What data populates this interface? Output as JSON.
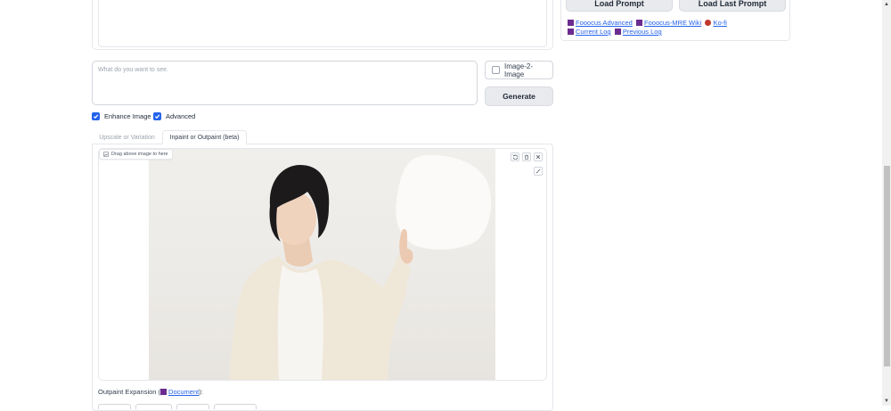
{
  "right_panel": {
    "load_prompt_label": "Load Prompt",
    "load_last_prompt_label": "Load Last Prompt",
    "links": [
      {
        "label": "Fooocus Advanced",
        "icon": "book-icon"
      },
      {
        "label": "Fooocus-MRE Wiki",
        "icon": "book-icon"
      },
      {
        "label": "Ko-fi",
        "icon": "ko-fi-icon"
      },
      {
        "label": "Current Log",
        "icon": "book-icon"
      },
      {
        "label": "Previous Log",
        "icon": "book-icon"
      }
    ]
  },
  "prompt": {
    "placeholder": "What do you want to see.",
    "value": ""
  },
  "image2image": {
    "label": "Image-2-Image",
    "checked": false
  },
  "generate": {
    "label": "Generate"
  },
  "options": {
    "enhance_image": {
      "label": "Enhance Image",
      "checked": true
    },
    "advanced": {
      "label": "Advanced",
      "checked": true
    }
  },
  "tabs": [
    {
      "label": "Upscale or Variation",
      "active": false
    },
    {
      "label": "Inpaint or Outpaint (beta)",
      "active": true
    }
  ],
  "editor": {
    "drag_label": "Drag above image to here",
    "tools": [
      "undo-icon",
      "clear-icon",
      "close-icon",
      "brush-icon"
    ]
  },
  "outpaint": {
    "prefix": "Outpaint Expansion (",
    "link_label": "Document",
    "suffix": "):"
  },
  "colors": {
    "accent": "#2563eb",
    "button_gray": "#e9eaed",
    "link": "#2563eb"
  }
}
